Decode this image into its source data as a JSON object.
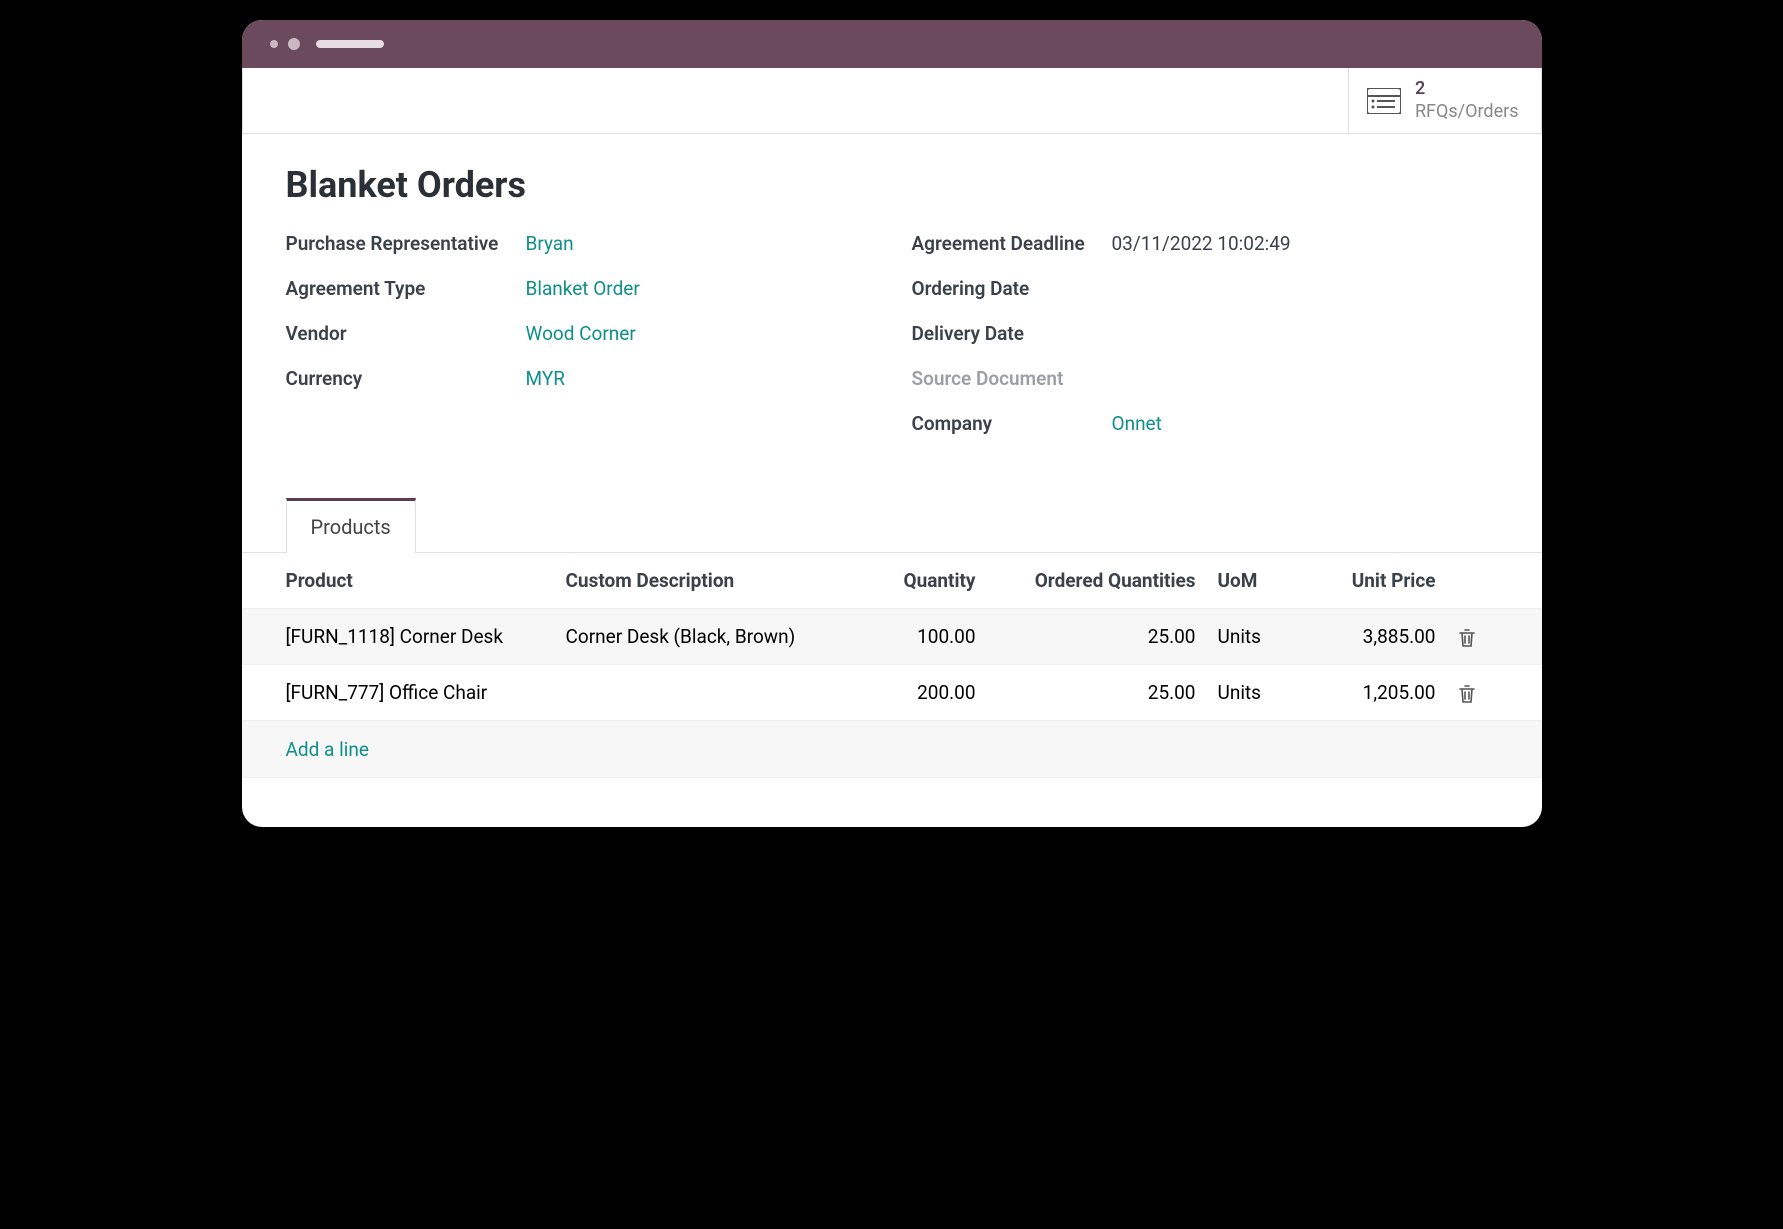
{
  "stat": {
    "count": "2",
    "label": "RFQs/Orders"
  },
  "title": "Blanket Orders",
  "left_fields": {
    "rep": {
      "label": "Purchase Representative",
      "value": "Bryan"
    },
    "type": {
      "label": "Agreement Type",
      "value": "Blanket Order"
    },
    "vendor": {
      "label": "Vendor",
      "value": "Wood Corner"
    },
    "currency": {
      "label": "Currency",
      "value": "MYR"
    }
  },
  "right_fields": {
    "deadline": {
      "label": "Agreement Deadline",
      "value": "03/11/2022 10:02:49"
    },
    "ordering": {
      "label": "Ordering Date",
      "value": ""
    },
    "delivery": {
      "label": "Delivery Date",
      "value": ""
    },
    "source": {
      "label": "Source Document",
      "value": ""
    },
    "company": {
      "label": "Company",
      "value": "Onnet"
    }
  },
  "tab": "Products",
  "columns": {
    "product": "Product",
    "desc": "Custom Description",
    "qty": "Quantity",
    "ord": "Ordered Quantities",
    "uom": "UoM",
    "price": "Unit Price"
  },
  "rows": [
    {
      "product": "[FURN_1118] Corner Desk",
      "desc": "Corner Desk (Black, Brown)",
      "qty": "100.00",
      "ord": "25.00",
      "uom": "Units",
      "price": "3,885.00"
    },
    {
      "product": "[FURN_777] Office Chair",
      "desc": "",
      "qty": "200.00",
      "ord": "25.00",
      "uom": "Units",
      "price": "1,205.00"
    }
  ],
  "add_line": "Add a line"
}
